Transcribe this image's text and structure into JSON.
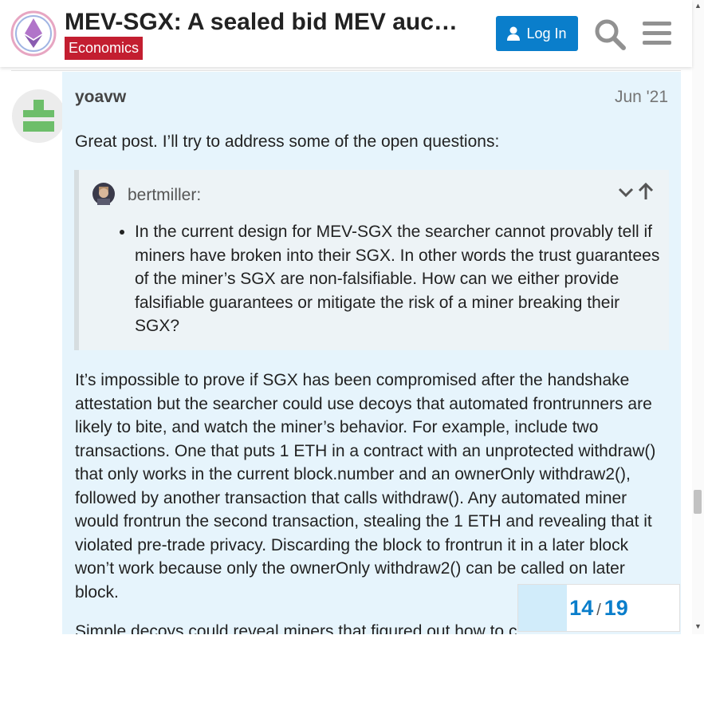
{
  "header": {
    "title": "MEV-SGX: A sealed bid MEV auction design",
    "category": "Economics",
    "login_label": "Log In",
    "category_color": "#c31e30",
    "accent_color": "#0a7ecb"
  },
  "post": {
    "username": "yoavw",
    "date": "Jun '21",
    "intro": "Great post. I’ll try to address some of the open questions:",
    "quote": {
      "author": "bertmiller:",
      "items": [
        "In the current design for MEV-SGX the searcher cannot provably tell if miners have broken into their SGX. In other words the trust guarantees of the miner’s SGX are non-falsifiable. How can we either provide falsifiable guarantees or mitigate the risk of a miner breaking their SGX?"
      ]
    },
    "body": "It’s impossible to prove if SGX has been compromised after the handshake attestation but the searcher could use decoys that automated frontrunners are likely to bite, and watch the miner’s behavior. For example, include two transactions. One that puts 1 ETH in a contract with an unprotected withdraw() that only works in the current block.number and an ownerOnly withdraw2(), followed by another transaction that calls withdraw(). Any automated miner would frontrun the second transaction, stealing the 1 ETH and revealing that it violated pre-trade privacy. Discarding the block to frontrun it in a later block won’t work because only the ownerOnly withdraw2() can be called on later block.",
    "continuation": "Simple decoys could reveal miners that figured out how to c"
  },
  "progress": {
    "current": "14",
    "separator": "/",
    "total": "19",
    "fraction": 0.3
  },
  "icons": {
    "search": "search-icon",
    "menu": "hamburger-menu-icon",
    "expand": "chevron-down-icon",
    "jump": "arrow-up-icon"
  }
}
